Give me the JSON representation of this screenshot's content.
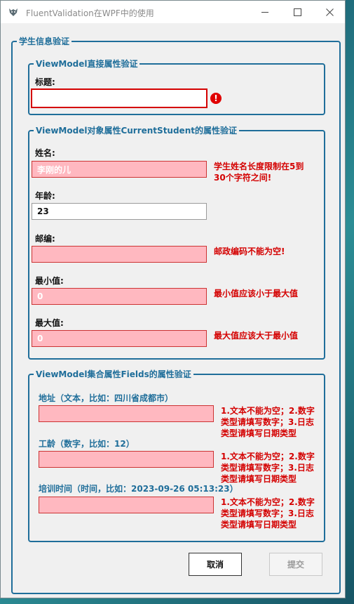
{
  "window": {
    "title": "FluentValidation在WPF中的使用"
  },
  "outer_group": {
    "legend": "学生信息验证"
  },
  "group1": {
    "legend": "ViewModel直接属性验证",
    "title_label": "标题:",
    "title_value": ""
  },
  "group2": {
    "legend": "ViewModel对象属性CurrentStudent的属性验证",
    "name_label": "姓名:",
    "name_value": "李刚的儿",
    "name_error": "学生姓名长度限制在5到30个字符之间!",
    "age_label": "年龄:",
    "age_value": "23",
    "zip_label": "邮编:",
    "zip_value": "",
    "zip_error": "邮政编码不能为空!",
    "min_label": "最小值:",
    "min_value": "0",
    "min_error": "最小值应该小于最大值",
    "max_label": "最大值:",
    "max_value": "0",
    "max_error": "最大值应该大于最小值"
  },
  "group3": {
    "legend": "ViewModel集合属性Fields的属性验证",
    "fields": [
      {
        "label": "地址（文本，比如：四川省成都市）",
        "value": "",
        "error": "1.文本不能为空；2.数字类型请填写数字；3.日志类型请填写日期类型"
      },
      {
        "label": "工龄（数字，比如：12）",
        "value": "",
        "error": "1.文本不能为空；2.数字类型请填写数字；3.日志类型请填写日期类型"
      },
      {
        "label": "培训时间（时间，比如：2023-09-26 05:13:23）",
        "value": "",
        "error": "1.文本不能为空；2.数字类型请填写数字；3.日志类型请填写日期类型"
      }
    ]
  },
  "buttons": {
    "cancel": "取消",
    "submit": "提交"
  },
  "colors": {
    "accent": "#1f6e9a",
    "error": "#d40000",
    "error_fill": "#ffb8c0"
  }
}
